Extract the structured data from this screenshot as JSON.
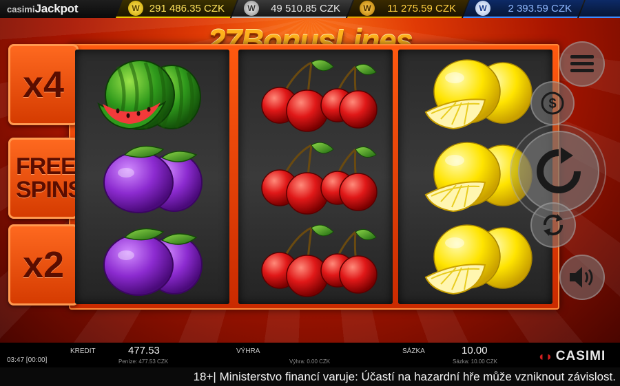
{
  "jackpot": {
    "brand": "casimi",
    "brand_suffix": "Jackpot",
    "items": [
      {
        "tier": "gold",
        "value": "291 486.35 CZK",
        "color": "#ffe35c"
      },
      {
        "tier": "silver",
        "value": "49 510.85 CZK",
        "color": "#e8e8e8"
      },
      {
        "tier": "bronze",
        "value": "11 275.59 CZK",
        "color": "#ffcf40"
      },
      {
        "tier": "blue",
        "value": "2 393.59 CZK",
        "color": "#8fb8ff"
      }
    ]
  },
  "game": {
    "title": "27BonusLines",
    "side_plates": [
      "x4",
      "FREE SPINS",
      "x2"
    ],
    "reels": [
      [
        "watermelon",
        "plum",
        "plum"
      ],
      [
        "cherry",
        "cherry",
        "cherry"
      ],
      [
        "lemon",
        "lemon",
        "lemon"
      ]
    ],
    "controls": {
      "menu": "menu-icon",
      "bet": "coin-icon",
      "spin": "spin-icon",
      "autoplay": "autoplay-icon",
      "sound": "sound-icon"
    }
  },
  "info": {
    "time": "03:47 [00:00]",
    "credit_label": "KREDIT",
    "credit_value": "477.53",
    "credit_sub": "Peníze: 477.53 CZK",
    "win_label": "VÝHRA",
    "win_sub": "Výhra: 0.00 CZK",
    "bet_label": "SÁZKA",
    "bet_value": "10.00",
    "bet_sub": "Sázka: 10.00 CZK",
    "brand": "CASIMI"
  },
  "warning": "18+| Ministerstvo financí varuje: Účastí na hazardní hře může vzniknout závislost."
}
